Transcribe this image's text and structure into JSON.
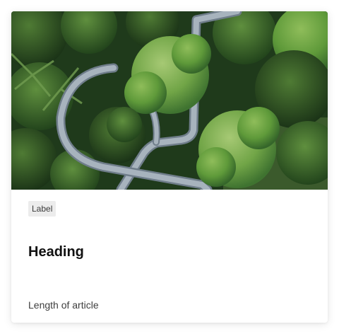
{
  "card": {
    "label": "Label",
    "heading": "Heading",
    "meta": "Length of article",
    "image_subject": "aerial view of a winding elevated walkway through a tree canopy"
  },
  "colors": {
    "card_background": "#ffffff",
    "badge_background": "#ececec",
    "heading_text": "#111111",
    "meta_text": "#3d3d3d"
  }
}
